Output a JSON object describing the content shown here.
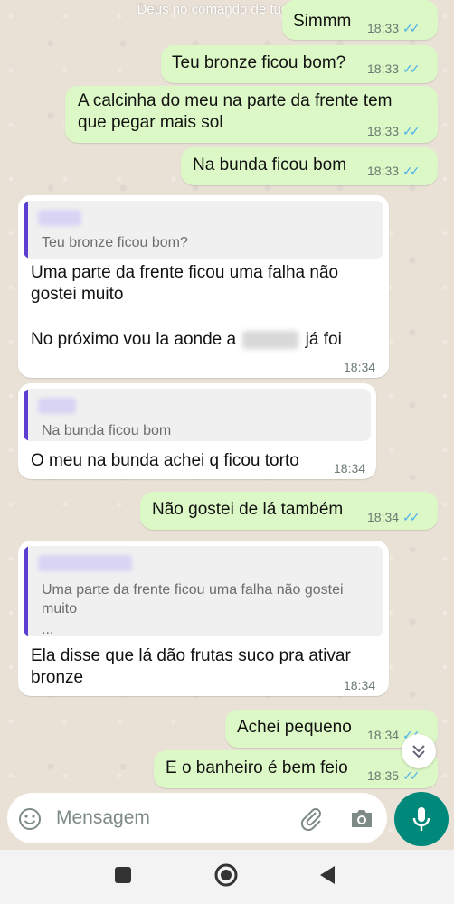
{
  "banner": {
    "text": "Deus no comando de tudo 🙌🏻"
  },
  "messages": [
    {
      "text": "Simmm",
      "time": "18:33"
    },
    {
      "text": "Teu bronze ficou bom?",
      "time": "18:33"
    },
    {
      "text": "A calcinha do meu na parte da frente tem que pegar mais sol",
      "time": "18:33"
    },
    {
      "text": "Na bunda ficou bom",
      "time": "18:33"
    },
    {
      "quote": "Teu bronze ficou bom?",
      "line1": "Uma parte da frente ficou uma falha não gostei muito",
      "line2_a": "No próximo vou la aonde a",
      "line2_b": "já foi",
      "time": "18:34"
    },
    {
      "quote": "Na bunda ficou bom",
      "text": "O meu na bunda achei q ficou torto",
      "time": "18:34"
    },
    {
      "text": "Não gostei de lá também",
      "time": "18:34"
    },
    {
      "quote": "Uma parte da frente ficou uma falha não gostei muito",
      "quote_more": "...",
      "text": "Ela disse que lá dão frutas suco pra ativar bronze",
      "time": "18:34"
    },
    {
      "text": "Achei pequeno",
      "time": "18:34"
    },
    {
      "text": "E o banheiro é bem feio",
      "time": "18:35"
    }
  ],
  "composer": {
    "placeholder": "Mensagem"
  },
  "icons": {
    "emoji": "emoji-icon",
    "attach": "paperclip-icon",
    "camera": "camera-icon",
    "mic": "microphone-icon",
    "scroll": "double-chevron-down-icon",
    "nav_recents": "square-icon",
    "nav_home": "circle-icon",
    "nav_back": "triangle-back-icon"
  },
  "colors": {
    "outgoing": "#dcf8c6",
    "incoming": "#ffffff",
    "accent": "#00897b",
    "ticks": "#4fb3e8",
    "quote_bar": "#5b3fd1"
  }
}
